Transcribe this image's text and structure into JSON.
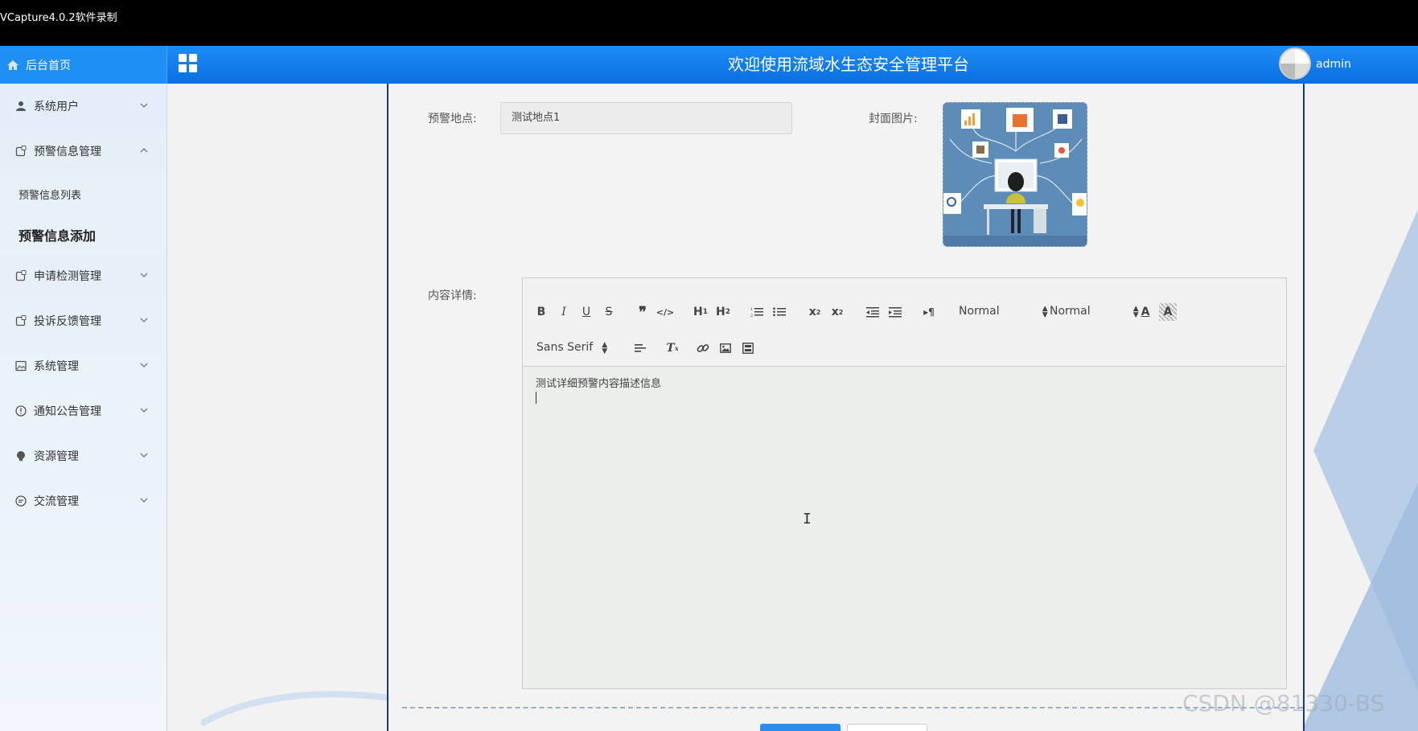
{
  "recorder": {
    "title": "VCapture4.0.2软件录制"
  },
  "header": {
    "home_label": "后台首页",
    "title": "欢迎使用流域水生态安全管理平台",
    "username": "admin"
  },
  "sidebar": {
    "items": [
      {
        "label": "系统用户",
        "icon": "user-icon"
      },
      {
        "label": "预警信息管理",
        "icon": "document-icon",
        "expanded": true
      },
      {
        "label": "申请检测管理",
        "icon": "document-icon"
      },
      {
        "label": "投诉反馈管理",
        "icon": "document-icon"
      },
      {
        "label": "系统管理",
        "icon": "image-icon"
      },
      {
        "label": "通知公告管理",
        "icon": "info-icon"
      },
      {
        "label": "资源管理",
        "icon": "bulb-icon"
      },
      {
        "label": "交流管理",
        "icon": "chat-icon"
      }
    ],
    "subitems": [
      {
        "label": "预警信息列表"
      },
      {
        "label": "预警信息添加",
        "active": true
      }
    ]
  },
  "form": {
    "location_label": "预警地点:",
    "location_value": "测试地点1",
    "cover_label": "封面图片:",
    "content_label": "内容详情:"
  },
  "editor": {
    "header_picker": "Normal",
    "size_picker": "Normal",
    "font_picker": "Sans Serif",
    "content": "测试详细预警内容描述信息"
  },
  "watermark": "CSDN @81330-BS"
}
